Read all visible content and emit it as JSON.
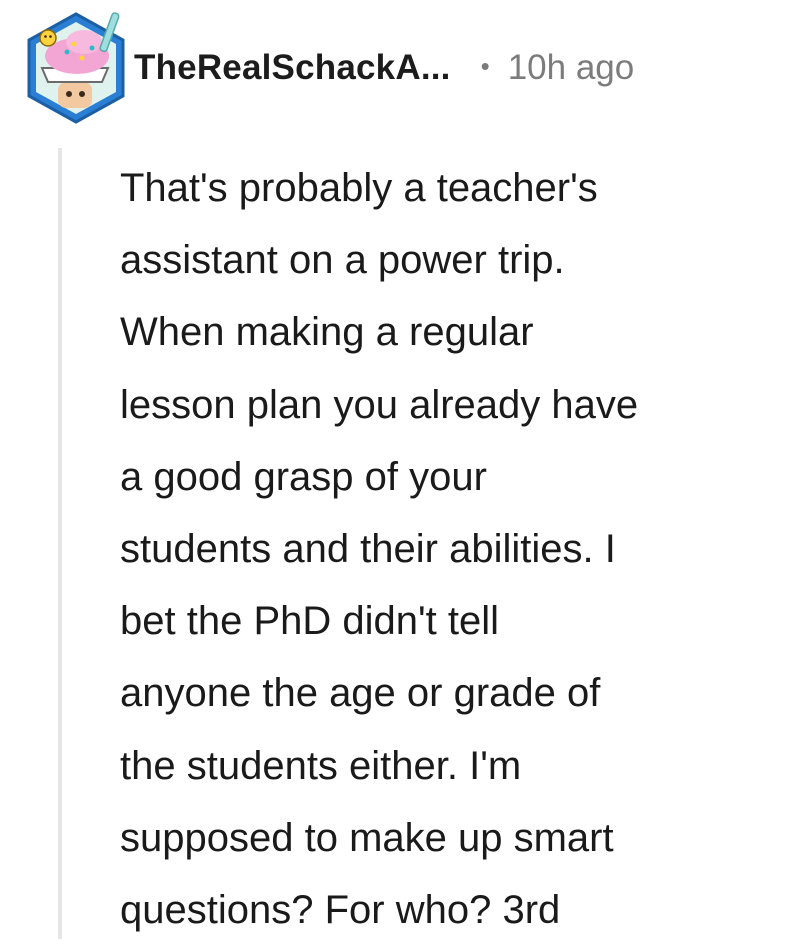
{
  "comment": {
    "author": "TheRealSchackA...",
    "separator": "•",
    "timestamp": "10h ago",
    "avatar_icon": "ice-cream-sundae-avatar-icon",
    "body_lines": [
      "That's probably a teacher's",
      "assistant on a power trip.",
      "When making a regular",
      "lesson plan you already have",
      "a good grasp of your",
      "students and their abilities. I",
      "bet the PhD didn't tell",
      "anyone the age or grade of",
      "the students either. I'm",
      "supposed to make up smart",
      "questions? For who? 3rd"
    ]
  },
  "colors": {
    "username": "#1c1c1c",
    "meta": "#7c7c7c",
    "body": "#1a1a1b",
    "thread_line": "#e6e6e6",
    "avatar_ring": "#2a7fd4"
  }
}
